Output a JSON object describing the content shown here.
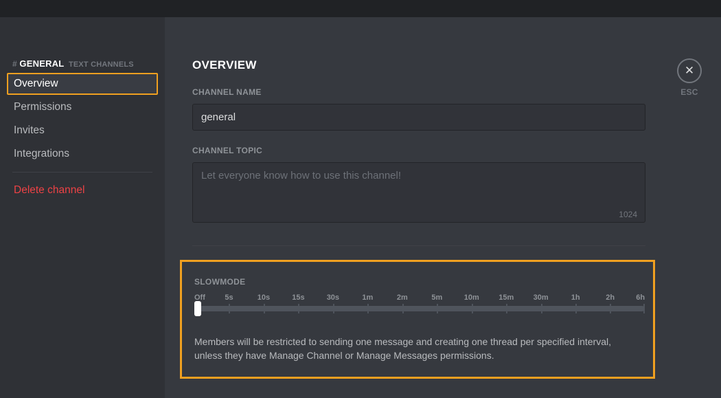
{
  "sidebar": {
    "hash": "#",
    "channel_name": "GENERAL",
    "subtitle": "TEXT CHANNELS",
    "items": [
      {
        "label": "Overview",
        "active": true
      },
      {
        "label": "Permissions",
        "active": false
      },
      {
        "label": "Invites",
        "active": false
      },
      {
        "label": "Integrations",
        "active": false
      }
    ],
    "delete_label": "Delete channel"
  },
  "main": {
    "title": "OVERVIEW",
    "channel_name": {
      "label": "CHANNEL NAME",
      "value": "general"
    },
    "channel_topic": {
      "label": "CHANNEL TOPIC",
      "placeholder": "Let everyone know how to use this channel!",
      "value": "",
      "char_count": "1024"
    },
    "slowmode": {
      "label": "SLOWMODE",
      "ticks": [
        "Off",
        "5s",
        "10s",
        "15s",
        "30s",
        "1m",
        "2m",
        "5m",
        "10m",
        "15m",
        "30m",
        "1h",
        "2h",
        "6h"
      ],
      "value_index": 0,
      "description": "Members will be restricted to sending one message and creating one thread per specified interval, unless they have Manage Channel or Manage Messages permissions."
    }
  },
  "close": {
    "label": "ESC",
    "glyph": "✕"
  }
}
